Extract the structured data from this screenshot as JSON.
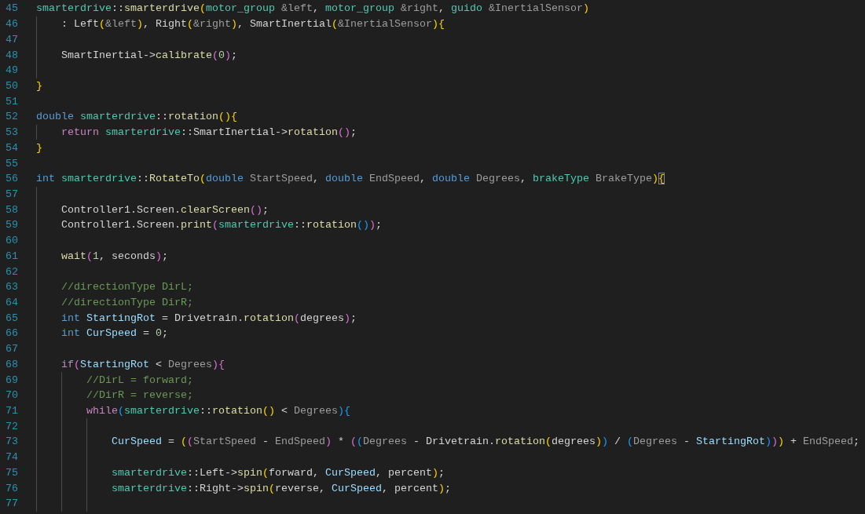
{
  "editor": {
    "lines": [
      {
        "number": "45",
        "tokens": [
          {
            "kind": "ns",
            "text": "smarterdrive"
          },
          {
            "kind": "plain",
            "text": "::"
          },
          {
            "kind": "fn",
            "text": "smarterdrive"
          },
          {
            "kind": "b1",
            "text": "("
          },
          {
            "kind": "type",
            "text": "motor_group "
          },
          {
            "kind": "param",
            "text": "&left"
          },
          {
            "kind": "plain",
            "text": ", "
          },
          {
            "kind": "type",
            "text": "motor_group "
          },
          {
            "kind": "param",
            "text": "&right"
          },
          {
            "kind": "plain",
            "text": ", "
          },
          {
            "kind": "type",
            "text": "guido "
          },
          {
            "kind": "param",
            "text": "&InertialSensor"
          },
          {
            "kind": "b1",
            "text": ")"
          }
        ]
      },
      {
        "number": "46",
        "tokens": [
          {
            "kind": "plain",
            "text": "    : Left"
          },
          {
            "kind": "b1",
            "text": "("
          },
          {
            "kind": "param",
            "text": "&left"
          },
          {
            "kind": "b1",
            "text": ")"
          },
          {
            "kind": "plain",
            "text": ", Right"
          },
          {
            "kind": "b1",
            "text": "("
          },
          {
            "kind": "param",
            "text": "&right"
          },
          {
            "kind": "b1",
            "text": ")"
          },
          {
            "kind": "plain",
            "text": ", SmartInertial"
          },
          {
            "kind": "b1",
            "text": "("
          },
          {
            "kind": "param",
            "text": "&InertialSensor"
          },
          {
            "kind": "b1",
            "text": "){"
          }
        ]
      },
      {
        "number": "47"
      },
      {
        "number": "48",
        "tokens": [
          {
            "kind": "plain",
            "text": "    SmartInertial->"
          },
          {
            "kind": "fn",
            "text": "calibrate"
          },
          {
            "kind": "b2",
            "text": "("
          },
          {
            "kind": "num",
            "text": "0"
          },
          {
            "kind": "b2",
            "text": ")"
          },
          {
            "kind": "plain",
            "text": ";"
          }
        ]
      },
      {
        "number": "49"
      },
      {
        "number": "50",
        "tokens": [
          {
            "kind": "b1",
            "text": "}"
          }
        ]
      },
      {
        "number": "51"
      },
      {
        "number": "52",
        "tokens": [
          {
            "kind": "kw",
            "text": "double "
          },
          {
            "kind": "ns",
            "text": "smarterdrive"
          },
          {
            "kind": "plain",
            "text": "::"
          },
          {
            "kind": "fn",
            "text": "rotation"
          },
          {
            "kind": "b1",
            "text": "(){"
          }
        ]
      },
      {
        "number": "53",
        "tokens": [
          {
            "kind": "ctl",
            "text": "    return "
          },
          {
            "kind": "ns",
            "text": "smarterdrive"
          },
          {
            "kind": "plain",
            "text": "::SmartInertial->"
          },
          {
            "kind": "fn",
            "text": "rotation"
          },
          {
            "kind": "b2",
            "text": "()"
          },
          {
            "kind": "plain",
            "text": ";"
          }
        ]
      },
      {
        "number": "54",
        "tokens": [
          {
            "kind": "b1",
            "text": "}"
          }
        ]
      },
      {
        "number": "55"
      },
      {
        "number": "56",
        "tokens": [
          {
            "kind": "kw",
            "text": "int "
          },
          {
            "kind": "ns",
            "text": "smarterdrive"
          },
          {
            "kind": "plain",
            "text": "::"
          },
          {
            "kind": "fn",
            "text": "RotateTo"
          },
          {
            "kind": "b1",
            "text": "("
          },
          {
            "kind": "kw",
            "text": "double "
          },
          {
            "kind": "param",
            "text": "StartSpeed"
          },
          {
            "kind": "plain",
            "text": ", "
          },
          {
            "kind": "kw",
            "text": "double "
          },
          {
            "kind": "param",
            "text": "EndSpeed"
          },
          {
            "kind": "plain",
            "text": ", "
          },
          {
            "kind": "kw",
            "text": "double "
          },
          {
            "kind": "param",
            "text": "Degrees"
          },
          {
            "kind": "plain",
            "text": ", "
          },
          {
            "kind": "type",
            "text": "brakeType "
          },
          {
            "kind": "param",
            "text": "BrakeType"
          },
          {
            "kind": "b1",
            "text": ")"
          },
          {
            "kind": "bm",
            "text": "{"
          }
        ]
      },
      {
        "number": "57"
      },
      {
        "number": "58",
        "tokens": [
          {
            "kind": "plain",
            "text": "    Controller1.Screen."
          },
          {
            "kind": "fn",
            "text": "clearScreen"
          },
          {
            "kind": "b2",
            "text": "()"
          },
          {
            "kind": "plain",
            "text": ";"
          }
        ]
      },
      {
        "number": "59",
        "tokens": [
          {
            "kind": "plain",
            "text": "    Controller1.Screen."
          },
          {
            "kind": "fn",
            "text": "print"
          },
          {
            "kind": "b2",
            "text": "("
          },
          {
            "kind": "ns",
            "text": "smarterdrive"
          },
          {
            "kind": "plain",
            "text": "::"
          },
          {
            "kind": "fn",
            "text": "rotation"
          },
          {
            "kind": "b3",
            "text": "()"
          },
          {
            "kind": "b2",
            "text": ")"
          },
          {
            "kind": "plain",
            "text": ";"
          }
        ]
      },
      {
        "number": "60"
      },
      {
        "number": "61",
        "tokens": [
          {
            "kind": "fn",
            "text": "    wait"
          },
          {
            "kind": "b2",
            "text": "("
          },
          {
            "kind": "num",
            "text": "1"
          },
          {
            "kind": "plain",
            "text": ", seconds"
          },
          {
            "kind": "b2",
            "text": ")"
          },
          {
            "kind": "plain",
            "text": ";"
          }
        ]
      },
      {
        "number": "62"
      },
      {
        "number": "63",
        "tokens": [
          {
            "kind": "comment",
            "text": "    //directionType DirL;"
          }
        ]
      },
      {
        "number": "64",
        "tokens": [
          {
            "kind": "comment",
            "text": "    //directionType DirR;"
          }
        ]
      },
      {
        "number": "65",
        "tokens": [
          {
            "kind": "kw",
            "text": "    int "
          },
          {
            "kind": "var",
            "text": "StartingRot"
          },
          {
            "kind": "plain",
            "text": " = Drivetrain."
          },
          {
            "kind": "fn",
            "text": "rotation"
          },
          {
            "kind": "b2",
            "text": "("
          },
          {
            "kind": "plain",
            "text": "degrees"
          },
          {
            "kind": "b2",
            "text": ")"
          },
          {
            "kind": "plain",
            "text": ";"
          }
        ]
      },
      {
        "number": "66",
        "tokens": [
          {
            "kind": "kw",
            "text": "    int "
          },
          {
            "kind": "var",
            "text": "CurSpeed"
          },
          {
            "kind": "plain",
            "text": " = "
          },
          {
            "kind": "num",
            "text": "0"
          },
          {
            "kind": "plain",
            "text": ";"
          }
        ]
      },
      {
        "number": "67"
      },
      {
        "number": "68",
        "tokens": [
          {
            "kind": "ctl",
            "text": "    if"
          },
          {
            "kind": "b2",
            "text": "("
          },
          {
            "kind": "var",
            "text": "StartingRot"
          },
          {
            "kind": "plain",
            "text": " < "
          },
          {
            "kind": "param",
            "text": "Degrees"
          },
          {
            "kind": "b2",
            "text": "){"
          }
        ]
      },
      {
        "number": "69",
        "tokens": [
          {
            "kind": "comment",
            "text": "        //DirL = forward;"
          }
        ]
      },
      {
        "number": "70",
        "tokens": [
          {
            "kind": "comment",
            "text": "        //DirR = reverse;"
          }
        ]
      },
      {
        "number": "71",
        "tokens": [
          {
            "kind": "ctl",
            "text": "        while"
          },
          {
            "kind": "b3",
            "text": "("
          },
          {
            "kind": "ns",
            "text": "smarterdrive"
          },
          {
            "kind": "plain",
            "text": "::"
          },
          {
            "kind": "fn",
            "text": "rotation"
          },
          {
            "kind": "b1",
            "text": "()"
          },
          {
            "kind": "plain",
            "text": " < "
          },
          {
            "kind": "param",
            "text": "Degrees"
          },
          {
            "kind": "b3",
            "text": "){"
          }
        ]
      },
      {
        "number": "72"
      },
      {
        "number": "73",
        "tokens": [
          {
            "kind": "var",
            "text": "            CurSpeed"
          },
          {
            "kind": "plain",
            "text": " = "
          },
          {
            "kind": "b1",
            "text": "("
          },
          {
            "kind": "b2",
            "text": "("
          },
          {
            "kind": "param",
            "text": "StartSpeed"
          },
          {
            "kind": "plain",
            "text": " - "
          },
          {
            "kind": "param",
            "text": "EndSpeed"
          },
          {
            "kind": "b2",
            "text": ")"
          },
          {
            "kind": "plain",
            "text": " * "
          },
          {
            "kind": "b2",
            "text": "("
          },
          {
            "kind": "b3",
            "text": "("
          },
          {
            "kind": "param",
            "text": "Degrees"
          },
          {
            "kind": "plain",
            "text": " - Drivetrain."
          },
          {
            "kind": "fn",
            "text": "rotation"
          },
          {
            "kind": "b1",
            "text": "("
          },
          {
            "kind": "plain",
            "text": "degrees"
          },
          {
            "kind": "b1",
            "text": ")"
          },
          {
            "kind": "b3",
            "text": ")"
          },
          {
            "kind": "plain",
            "text": " / "
          },
          {
            "kind": "b3",
            "text": "("
          },
          {
            "kind": "param",
            "text": "Degrees"
          },
          {
            "kind": "plain",
            "text": " - "
          },
          {
            "kind": "var",
            "text": "StartingRot"
          },
          {
            "kind": "b3",
            "text": ")"
          },
          {
            "kind": "b2",
            "text": ")"
          },
          {
            "kind": "b1",
            "text": ")"
          },
          {
            "kind": "plain",
            "text": " + "
          },
          {
            "kind": "param",
            "text": "EndSpeed"
          },
          {
            "kind": "plain",
            "text": ";"
          }
        ]
      },
      {
        "number": "74"
      },
      {
        "number": "75",
        "tokens": [
          {
            "kind": "ns",
            "text": "            smarterdrive"
          },
          {
            "kind": "plain",
            "text": "::Left->"
          },
          {
            "kind": "fn",
            "text": "spin"
          },
          {
            "kind": "b1",
            "text": "("
          },
          {
            "kind": "plain",
            "text": "forward, "
          },
          {
            "kind": "var",
            "text": "CurSpeed"
          },
          {
            "kind": "plain",
            "text": ", percent"
          },
          {
            "kind": "b1",
            "text": ")"
          },
          {
            "kind": "plain",
            "text": ";"
          }
        ]
      },
      {
        "number": "76",
        "tokens": [
          {
            "kind": "ns",
            "text": "            smarterdrive"
          },
          {
            "kind": "plain",
            "text": "::Right->"
          },
          {
            "kind": "fn",
            "text": "spin"
          },
          {
            "kind": "b1",
            "text": "("
          },
          {
            "kind": "plain",
            "text": "reverse, "
          },
          {
            "kind": "var",
            "text": "CurSpeed"
          },
          {
            "kind": "plain",
            "text": ", percent"
          },
          {
            "kind": "b1",
            "text": ")"
          },
          {
            "kind": "plain",
            "text": ";"
          }
        ]
      },
      {
        "number": "77"
      }
    ]
  }
}
